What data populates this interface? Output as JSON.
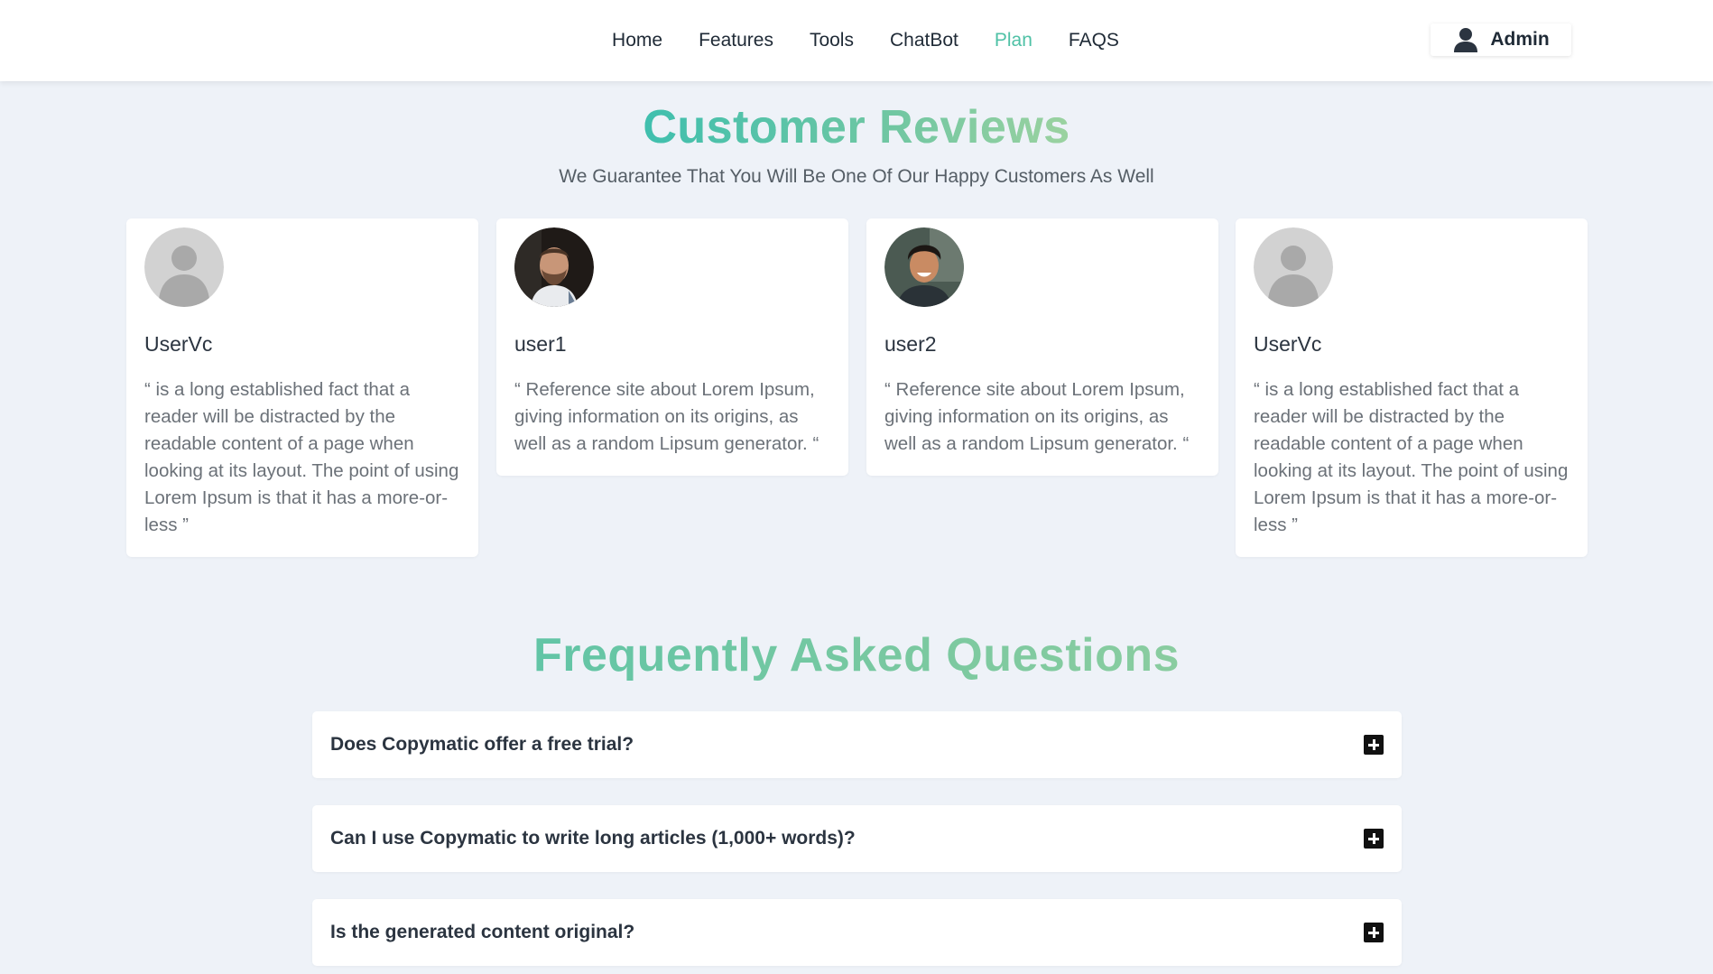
{
  "nav": {
    "items": [
      {
        "label": "Home",
        "active": false
      },
      {
        "label": "Features",
        "active": false
      },
      {
        "label": "Tools",
        "active": false
      },
      {
        "label": "ChatBot",
        "active": false
      },
      {
        "label": "Plan",
        "active": true
      },
      {
        "label": "FAQS",
        "active": false
      }
    ],
    "active_color": "#4fc1a6",
    "admin_label": "Admin",
    "admin_icon": "user-icon"
  },
  "reviews": {
    "title": "Customer Reviews",
    "subtitle": "We Guarantee That You Will Be One Of Our Happy Customers As Well",
    "cards": [
      {
        "name": "UserVc",
        "avatar": "default-avatar",
        "quote": "“ is a long established fact that a reader will be distracted by the readable content of a page when looking at its layout. The point of using Lorem Ipsum is that it has a more-or-less ”"
      },
      {
        "name": "user1",
        "avatar": "photo-avatar-bearded-man",
        "quote": "“ Reference site about Lorem Ipsum, giving information on its origins, as well as a random Lipsum generator. “"
      },
      {
        "name": "user2",
        "avatar": "photo-avatar-smiling-man",
        "quote": "“ Reference site about Lorem Ipsum, giving information on its origins, as well as a random Lipsum generator. “"
      },
      {
        "name": "UserVc",
        "avatar": "default-avatar",
        "quote": "“ is a long established fact that a reader will be distracted by the readable content of a page when looking at its layout. The point of using Lorem Ipsum is that it has a more-or-less ”"
      }
    ]
  },
  "faq": {
    "title": "Frequently Asked Questions",
    "items": [
      {
        "question": "Does Copymatic offer a free trial?"
      },
      {
        "question": "Can I use Copymatic to write long articles (1,000+ words)?"
      },
      {
        "question": "Is the generated content original?"
      }
    ],
    "expand_icon": "plus-square-icon"
  },
  "colors": {
    "page_bg": "#eef2f8",
    "title_gradient_start": "#3fbfae",
    "title_gradient_end": "#a8d5a0"
  }
}
